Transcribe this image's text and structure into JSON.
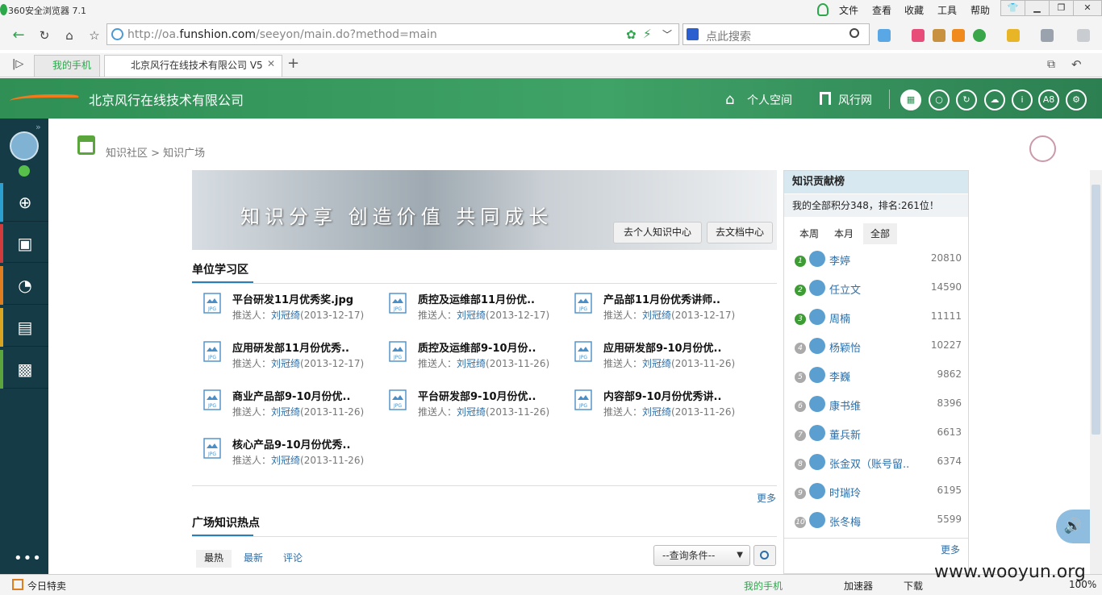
{
  "browser": {
    "app_title": "360安全浏览器 7.1",
    "menus": [
      "文件",
      "查看",
      "收藏",
      "工具",
      "帮助"
    ],
    "url_prefix": "http://oa.",
    "url_host": "funshion.com",
    "url_path": "/seeyon/main.do?method=main",
    "search_placeholder": "点此搜索",
    "tabs": [
      {
        "label": "我的手机"
      },
      {
        "label": "北京风行在线技术有限公司 V5"
      }
    ],
    "status": {
      "left": "今日特卖",
      "phone": "我的手机",
      "accel": "加速器",
      "download": "下载",
      "zoom": "100%"
    }
  },
  "header": {
    "company": "北京风行在线技术有限公司",
    "nav_personal": "个人空间",
    "nav_funshion": "风行网",
    "a8": "A8"
  },
  "breadcrumb": "知识社区 > 知识广场",
  "banner": {
    "slogan": "知识分享 创造价值 共同成长",
    "btn_personal": "去个人知识中心",
    "btn_docs": "去文档中心"
  },
  "study": {
    "title": "单位学习区",
    "meta_prefix": "推送人：",
    "more": "更多",
    "items": [
      {
        "name": "平台研发11月优秀奖.jpg",
        "who": "刘冠绮",
        "date": "(2013-12-17)"
      },
      {
        "name": "质控及运维部11月份优..",
        "who": "刘冠绮",
        "date": "(2013-12-17)"
      },
      {
        "name": "产品部11月份优秀讲师..",
        "who": "刘冠绮",
        "date": "(2013-12-17)"
      },
      {
        "name": "应用研发部11月份优秀..",
        "who": "刘冠绮",
        "date": "(2013-12-17)"
      },
      {
        "name": "质控及运维部9-10月份..",
        "who": "刘冠绮",
        "date": "(2013-11-26)"
      },
      {
        "name": "应用研发部9-10月份优..",
        "who": "刘冠绮",
        "date": "(2013-11-26)"
      },
      {
        "name": "商业产品部9-10月份优..",
        "who": "刘冠绮",
        "date": "(2013-11-26)"
      },
      {
        "name": "平台研发部9-10月份优..",
        "who": "刘冠绮",
        "date": "(2013-11-26)"
      },
      {
        "name": "内容部9-10月份优秀讲..",
        "who": "刘冠绮",
        "date": "(2013-11-26)"
      },
      {
        "name": "核心产品9-10月份优秀..",
        "who": "刘冠绮",
        "date": "(2013-11-26)"
      }
    ]
  },
  "hot": {
    "title": "广场知识热点",
    "tabs": [
      "最热",
      "最新",
      "评论"
    ],
    "select": "--查询条件--"
  },
  "ranking": {
    "title": "知识贡献榜",
    "summary": "我的全部积分348，排名:261位！",
    "tabs": [
      "本周",
      "本月",
      "全部"
    ],
    "more": "更多",
    "rows": [
      {
        "rank": "1",
        "name": "李婷",
        "score": "20810"
      },
      {
        "rank": "2",
        "name": "任立文",
        "score": "14590"
      },
      {
        "rank": "3",
        "name": "周楠",
        "score": "11111"
      },
      {
        "rank": "4",
        "name": "杨颖怡",
        "score": "10227"
      },
      {
        "rank": "5",
        "name": "李巍",
        "score": "9862"
      },
      {
        "rank": "6",
        "name": "康书维",
        "score": "8396"
      },
      {
        "rank": "7",
        "name": "董兵新",
        "score": "6613"
      },
      {
        "rank": "8",
        "name": "张金双（账号留..",
        "score": "6374"
      },
      {
        "rank": "9",
        "name": "时瑞玲",
        "score": "6195"
      },
      {
        "rank": "10",
        "name": "张冬梅",
        "score": "5599"
      }
    ]
  },
  "watermark": "www.wooyun.org",
  "colors": {
    "header_green": "#3fa266",
    "sidebar": "#153b47",
    "link": "#2f6fa8",
    "rank_head": "#d8e8f0"
  }
}
